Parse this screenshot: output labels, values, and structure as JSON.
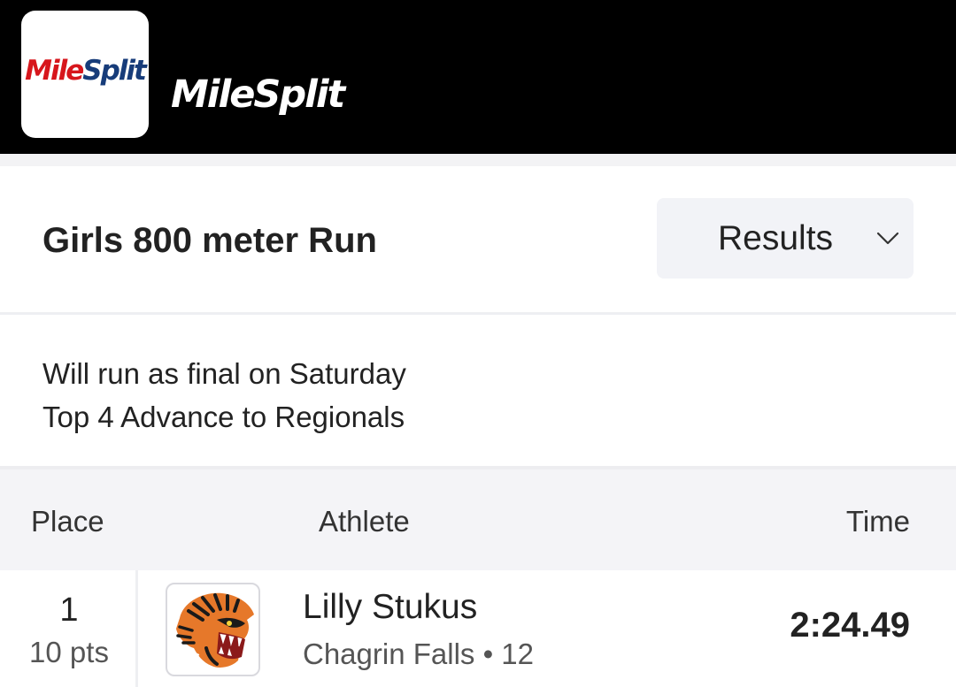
{
  "header": {
    "app_icon_logo": "MileSplit",
    "brand_text": "MileSplit",
    "colors": {
      "background": "#000000",
      "logo_red": "#d7161c",
      "logo_blue": "#173c7a"
    }
  },
  "event": {
    "title": "Girls 800 meter Run",
    "view_select": {
      "selected": "Results",
      "icon": "chevron-down-icon"
    }
  },
  "notes": {
    "line1": "Will run as final on Saturday",
    "line2": "Top 4 Advance to Regionals"
  },
  "table": {
    "columns": {
      "place": "Place",
      "athlete": "Athlete",
      "time": "Time"
    },
    "rows": [
      {
        "place": "1",
        "points": "10 pts",
        "team_logo": "tiger-mascot-logo",
        "athlete": "Lilly Stukus",
        "team_grade": "Chagrin Falls • 12",
        "time": "2:24.49"
      }
    ]
  }
}
